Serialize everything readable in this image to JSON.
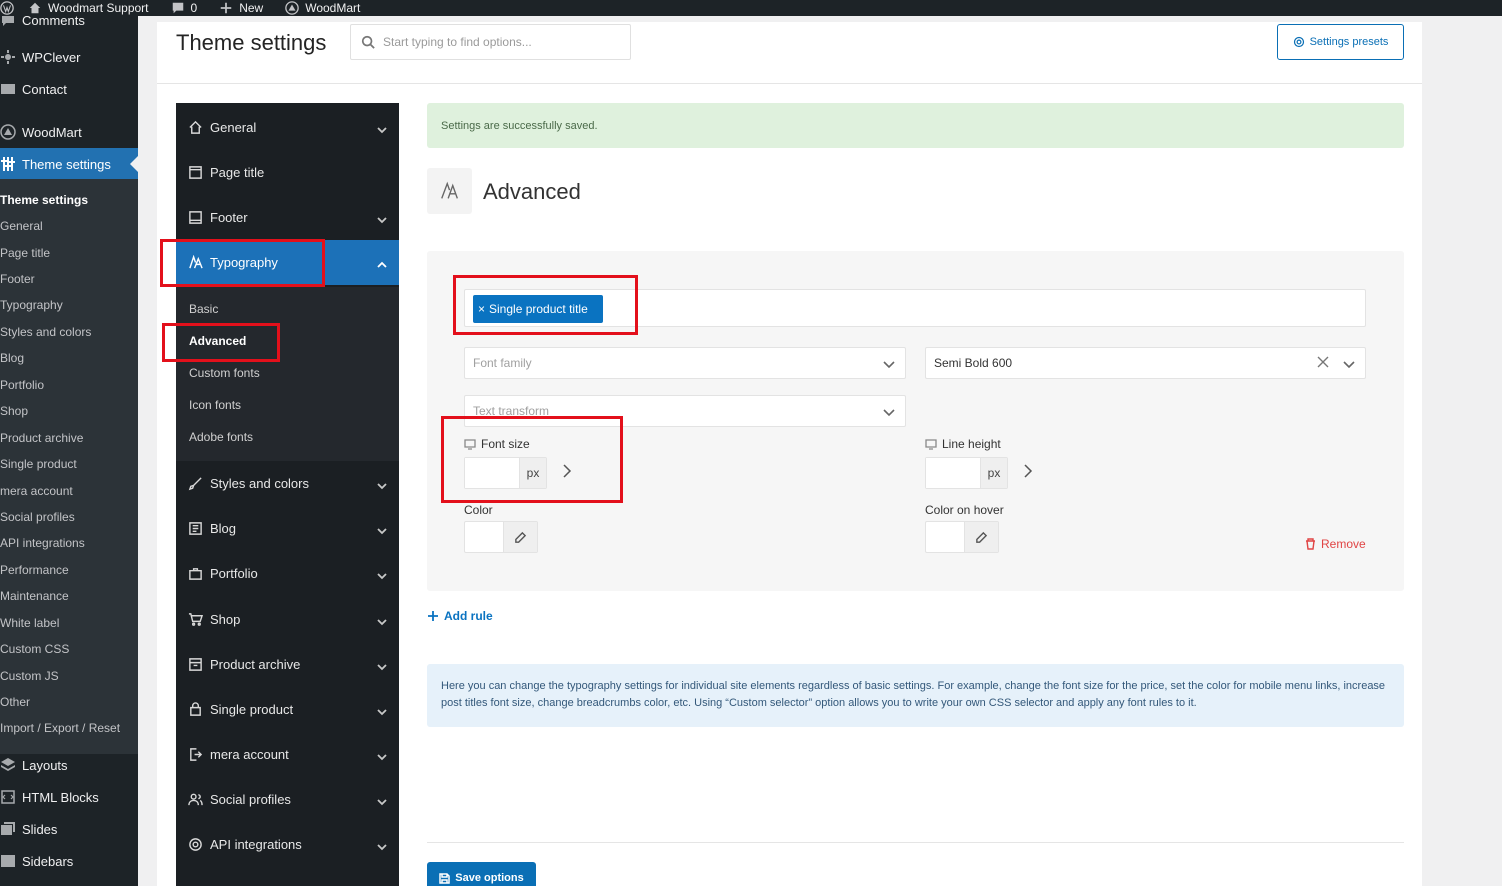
{
  "admin_bar": {
    "site_name": "Woodmart Support",
    "comments_count": "0",
    "new_label": "New",
    "theme_label": "WoodMart"
  },
  "wp_menu": {
    "top_items": [
      {
        "label": "Comments",
        "icon": "comments-icon"
      },
      {
        "label": "WPClever",
        "icon": "gear-icon"
      },
      {
        "label": "Contact",
        "icon": "envelope-icon"
      },
      {
        "label": "WoodMart",
        "icon": "woodmart-logo-icon"
      },
      {
        "label": "Theme settings",
        "icon": "sliders-icon"
      }
    ],
    "sub_items": [
      "Theme settings",
      "General",
      "Page title",
      "Footer",
      "Typography",
      "Styles and colors",
      "Blog",
      "Portfolio",
      "Shop",
      "Product archive",
      "Single product",
      "mera account",
      "Social profiles",
      "API integrations",
      "Performance",
      "Maintenance",
      "White label",
      "Custom CSS",
      "Custom JS",
      "Other",
      "Import / Export / Reset"
    ],
    "bottom_items": [
      {
        "label": "Layouts",
        "icon": "layers-icon"
      },
      {
        "label": "HTML Blocks",
        "icon": "code-icon"
      },
      {
        "label": "Slides",
        "icon": "slides-icon"
      },
      {
        "label": "Sidebars",
        "icon": "sidebar-icon"
      }
    ]
  },
  "header": {
    "title": "Theme settings",
    "search_placeholder": "Start typing to find options...",
    "presets_label": "Settings presets"
  },
  "options_nav": {
    "items": [
      {
        "label": "General",
        "icon": "home-icon",
        "chevron": true
      },
      {
        "label": "Page title",
        "icon": "page-icon",
        "chevron": false
      },
      {
        "label": "Footer",
        "icon": "footer-icon",
        "chevron": true
      },
      {
        "label": "Typography",
        "icon": "typography-icon",
        "chevron": true,
        "open": true
      },
      {
        "label": "Styles and colors",
        "icon": "brush-icon",
        "chevron": true
      },
      {
        "label": "Blog",
        "icon": "blog-icon",
        "chevron": true
      },
      {
        "label": "Portfolio",
        "icon": "briefcase-icon",
        "chevron": true
      },
      {
        "label": "Shop",
        "icon": "cart-icon",
        "chevron": true
      },
      {
        "label": "Product archive",
        "icon": "archive-icon",
        "chevron": true
      },
      {
        "label": "Single product",
        "icon": "bag-icon",
        "chevron": true
      },
      {
        "label": "mera account",
        "icon": "login-icon",
        "chevron": true
      },
      {
        "label": "Social profiles",
        "icon": "users-icon",
        "chevron": true
      },
      {
        "label": "API integrations",
        "icon": "api-gear-icon",
        "chevron": true
      }
    ],
    "typography_sub": [
      "Basic",
      "Advanced",
      "Custom fonts",
      "Icon fonts",
      "Adobe fonts"
    ],
    "active_sub": "Advanced"
  },
  "notice": "Settings are successfully saved.",
  "section": {
    "title": "Advanced",
    "icon": "typography-icon"
  },
  "rule": {
    "selector_tag": "Single product title",
    "font_family_placeholder": "Font family",
    "font_weight_value": "Semi Bold 600",
    "text_transform_placeholder": "Text transform",
    "font_size_label": "Font size",
    "line_height_label": "Line height",
    "unit": "px",
    "color_label": "Color",
    "color_hover_label": "Color on hover",
    "remove_label": "Remove"
  },
  "add_rule_label": "Add rule",
  "info_text": "Here you can change the typography settings for individual site elements regardless of basic settings. For example, change the font size for the price, set the color for mobile menu links, increase post titles font size, change breadcrumbs color, etc. Using “Custom selector” option allows you to write your own CSS selector and apply any font rules to it.",
  "save_label": "Save options",
  "colors": {
    "accent": "#0a73c1",
    "nav_bg": "#1b1f23",
    "notice_bg": "#dff1dd",
    "highlight": "#e3101b"
  }
}
